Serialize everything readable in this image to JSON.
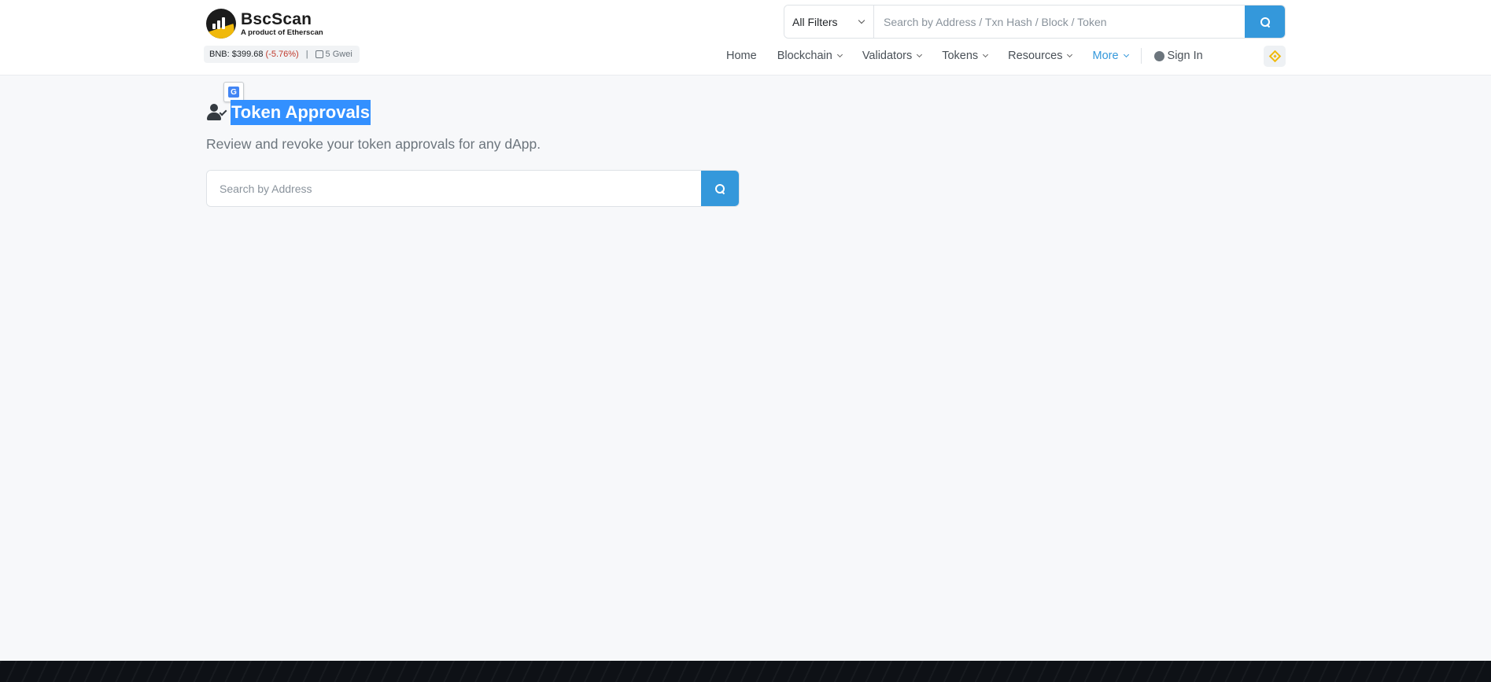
{
  "brand": {
    "name": "BscScan",
    "tagline": "A product of Etherscan"
  },
  "price_badge": {
    "price": "BNB: $399.68",
    "change": "(-5.76%)",
    "separator": "|",
    "gas": "5 Gwei"
  },
  "top_search": {
    "filter_label": "All Filters",
    "placeholder": "Search by Address / Txn Hash / Block / Token"
  },
  "nav": {
    "home": "Home",
    "blockchain": "Blockchain",
    "validators": "Validators",
    "tokens": "Tokens",
    "resources": "Resources",
    "more": "More",
    "sign_in": "Sign In"
  },
  "main": {
    "title": "Token Approvals",
    "subtitle": "Review and revoke your token approvals for any dApp.",
    "search_placeholder": "Search by Address"
  },
  "colors": {
    "accent": "#3498db",
    "brand_gold": "#f0b90b",
    "negative": "#c0392b",
    "selection": "#3390ff"
  },
  "icons": {
    "logo": "bscscan-logo-icon",
    "gas": "gas-pump-icon",
    "search": "search-icon",
    "user": "user-circle-icon",
    "bnb": "bnb-diamond-icon",
    "translate": "google-translate-icon",
    "approvals": "user-check-icon"
  }
}
